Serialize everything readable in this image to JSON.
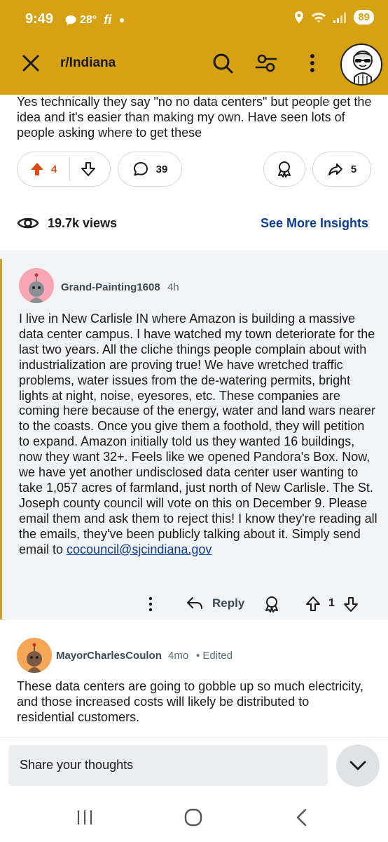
{
  "status_bar": {
    "time": "9:49",
    "temperature": "28°",
    "carrier_mark": "fi",
    "battery": "89"
  },
  "app_bar": {
    "subreddit": "r/Indiana"
  },
  "post": {
    "text": "Yes technically they say \"no no data centers\" but people get the idea and it's easier than making my own. Have seen lots of people asking where to get these",
    "upvotes": "4",
    "comments": "39",
    "shares": "5",
    "views": "19.7k views",
    "insights_label": "See More Insights"
  },
  "comments": [
    {
      "username": "Grand-Painting1608",
      "age": "4h",
      "body": "I live in New Carlisle IN where Amazon is building a massive data center campus. I have watched my town deteriorate for the last two years. All the cliche things people complain about with industrialization are proving true! We have wretched traffic problems, water issues from the de-watering permits, bright lights at night, noise, eyesores, etc. These companies are coming here because of the energy, water and land wars nearer to the coasts. Once you give them a foothold, they will petition to expand. Amazon initially told us they wanted 16 buildings, now they want 32+. Feels like we opened Pandora's Box. Now, we have yet another undisclosed data center user wanting to take 1,057 acres of farmland, just north of New Carlisle. The St. Joseph county council will vote on this on December 9. Please email them and ask them to reject this! I know they're reading all the emails, they've been publicly talking about it. Simply send email to ",
      "email_link": "cocouncil@sjcindiana.gov",
      "reply_label": "Reply",
      "votes": "1",
      "avatar_color": "#f8a5b4"
    },
    {
      "username": "MayorCharlesCoulon",
      "age": "4mo",
      "edited": "• Edited",
      "body": "These data centers are going to gobble up so much electricity, and those increased costs will likely be distributed to residential customers.",
      "avatar_color": "#f6a657"
    }
  ],
  "composer": {
    "placeholder": "Share your thoughts"
  },
  "colors": {
    "header": "#d6a214",
    "upvote_active": "#e14a0b",
    "link": "#0b3d91",
    "comment_bg": "#f2f3f4"
  },
  "icons": [
    "close-icon",
    "search-icon",
    "filter-icon",
    "more-vertical-icon",
    "upvote-icon",
    "downvote-icon",
    "comment-icon",
    "award-icon",
    "share-icon",
    "eye-icon",
    "reply-icon",
    "chevron-down-icon"
  ]
}
